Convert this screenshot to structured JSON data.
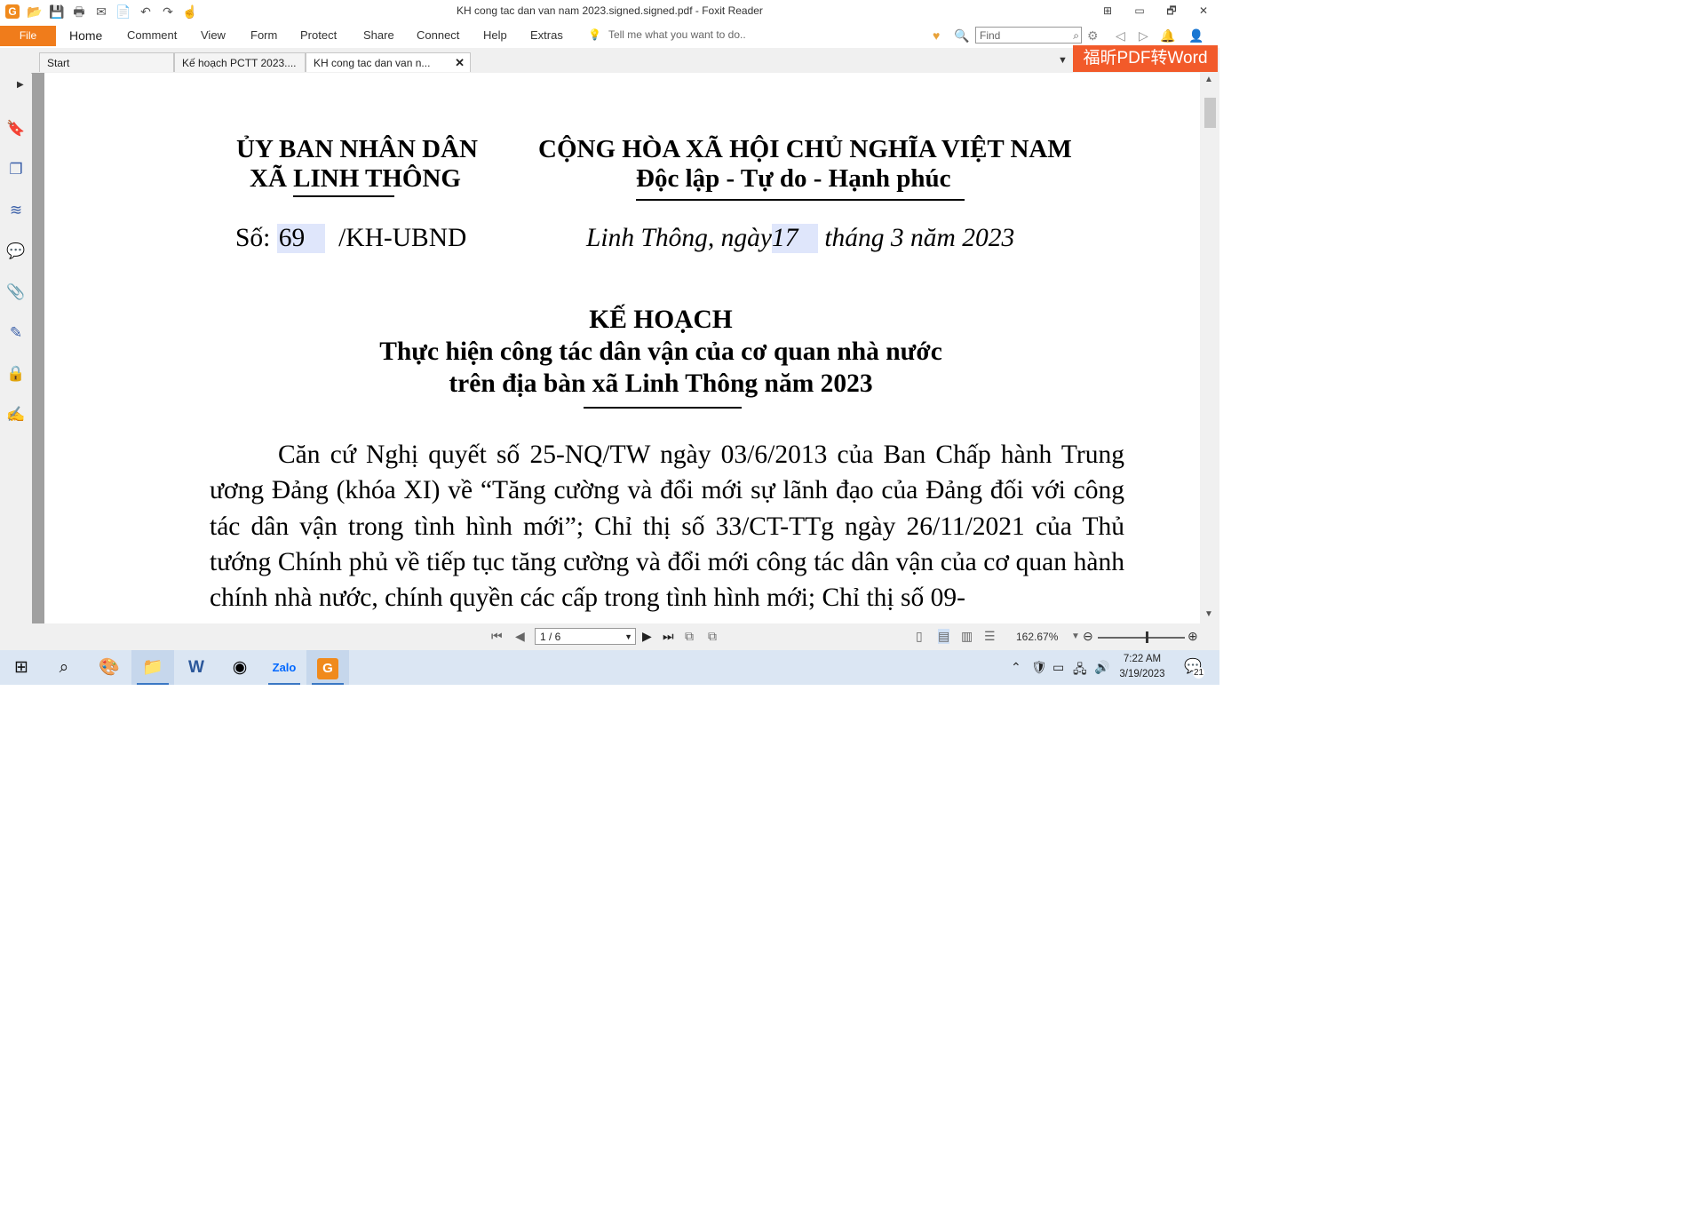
{
  "window": {
    "title": "KH cong tac dan van nam 2023.signed.signed.pdf - Foxit Reader",
    "controls": {
      "minimize": "▭",
      "restore": "🗗",
      "close": "✕",
      "grid": "⊞"
    }
  },
  "quick_access": {
    "icons": [
      "open-icon",
      "save-icon",
      "print-icon",
      "email-icon",
      "create-pdf-icon",
      "undo-icon",
      "redo-icon",
      "hand-tool-icon"
    ]
  },
  "ribbon": {
    "file": "File",
    "tabs": [
      "Home",
      "Comment",
      "View",
      "Form",
      "Protect",
      "Share",
      "Connect",
      "Help",
      "Extras"
    ],
    "tell_me": "Tell me what you want to do..",
    "find_placeholder": "Find"
  },
  "tabs": [
    {
      "label": "Start"
    },
    {
      "label": "Kế hoạch PCTT 2023...."
    },
    {
      "label": "KH cong tac dan van n..."
    }
  ],
  "promo": "福昕PDF转Word",
  "document": {
    "org_line1": "ỦY BAN NHÂN DÂN",
    "org_line2": "XÃ LINH THÔNG",
    "nation_line1": "CỘNG HÒA XÃ HỘI CHỦ NGHĨA VIỆT NAM",
    "nation_line2": "Độc lập - Tự do - Hạnh phúc",
    "so_label": "Số:",
    "so_value": "69",
    "so_suffix": "/KH-UBND",
    "date_prefix": "Linh Thông, ngày",
    "date_day": "17",
    "date_suffix": "tháng 3 năm 2023",
    "heading": "KẾ HOẠCH",
    "subtitle1": "Thực hiện công tác dân vận của cơ quan nhà nước",
    "subtitle2": "trên địa bàn xã Linh Thông năm 2023",
    "body": "Căn cứ Nghị quyết số 25-NQ/TW ngày 03/6/2013 của Ban Chấp hành Trung ương Đảng (khóa XI) về “Tăng cường và đổi mới sự lãnh đạo của Đảng đối với công tác dân vận trong tình hình mới”; Chỉ thị số 33/CT-TTg ngày 26/11/2021 của Thủ tướng Chính phủ về tiếp tục tăng cường và đổi mới công tác dân vận của cơ quan hành chính nhà nước, chính quyền các cấp trong tình hình mới; Chỉ thị số 09-"
  },
  "statusbar": {
    "page": "1 / 6",
    "zoom": "162.67%"
  },
  "taskbar": {
    "time": "7:22 AM",
    "date": "3/19/2023",
    "notifications": "21"
  }
}
